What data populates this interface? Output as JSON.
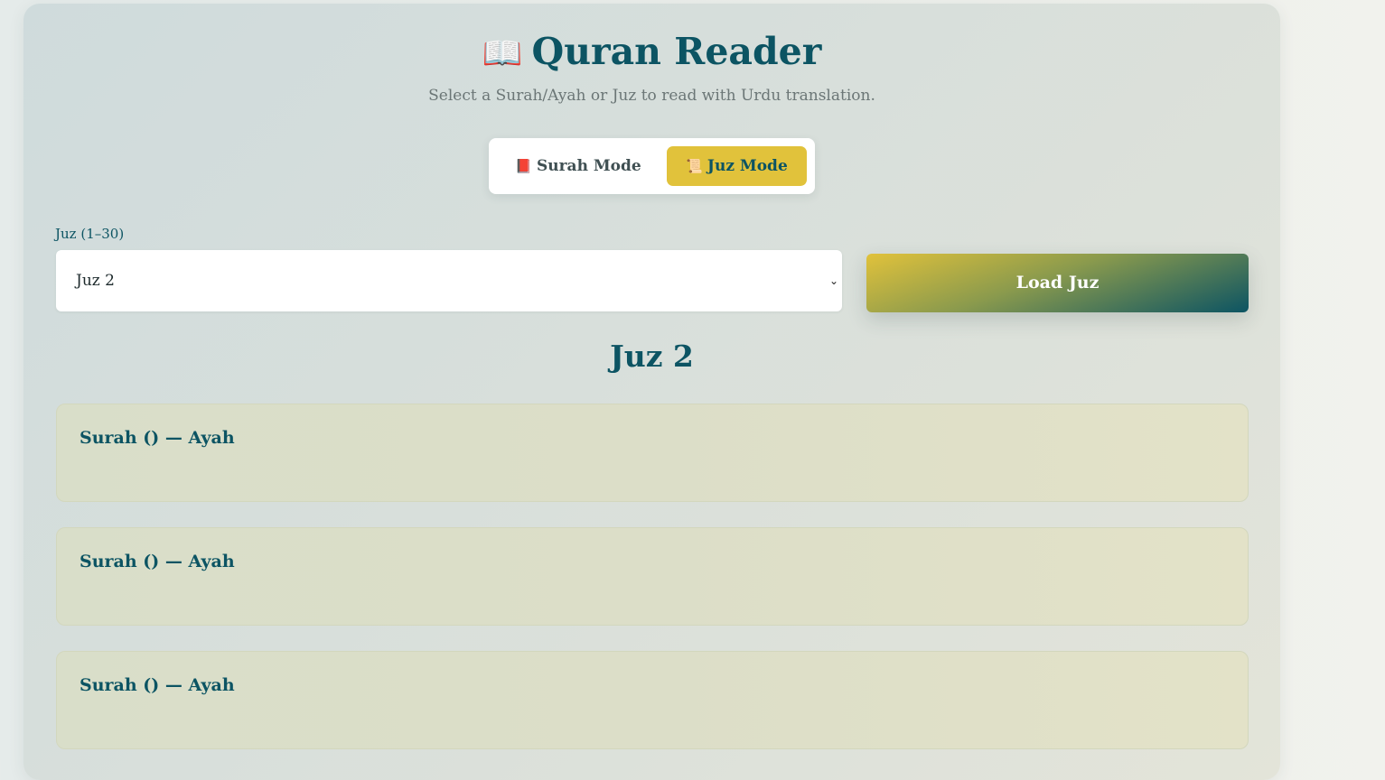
{
  "header": {
    "icon": "open-book-icon",
    "icon_glyph": "📖",
    "title": "Quran Reader",
    "subtitle": "Select a Surah/Ayah or Juz to read with Urdu translation."
  },
  "modes": {
    "surah": {
      "icon": "red-book-icon",
      "icon_glyph": "📕",
      "label": "Surah Mode",
      "active": false
    },
    "juz": {
      "icon": "scroll-icon",
      "icon_glyph": "📜",
      "label": "Juz Mode",
      "active": true
    }
  },
  "juz_select": {
    "label": "Juz (1–30)",
    "value": "Juz 2",
    "chevron": "chevron-down-icon"
  },
  "load_button": {
    "label": "Load Juz"
  },
  "results": {
    "heading": "Juz 2",
    "ayahs": [
      {
        "title": "Surah () — Ayah"
      },
      {
        "title": "Surah () — Ayah"
      },
      {
        "title": "Surah () — Ayah"
      }
    ]
  },
  "colors": {
    "accent": "#0c5463",
    "gold": "#e1c23b"
  }
}
